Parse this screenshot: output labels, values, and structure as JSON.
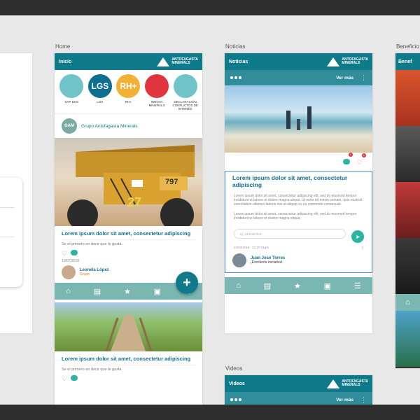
{
  "labels": {
    "home": "Home",
    "noticias": "Noticias",
    "videos": "Videos",
    "beneficios": "Beneficio"
  },
  "home": {
    "header_title": "Inicio",
    "logo_line1": "ANTOFAGASTA",
    "logo_line2": "MINERALS",
    "categories": [
      {
        "label": "SAP DHS",
        "icon": "worker-icon",
        "color": "#6fc3c9",
        "text": ""
      },
      {
        "label": "LGS",
        "icon": "lgs-icon",
        "color": "#0f6f8f",
        "text": "LGS"
      },
      {
        "label": "RH+",
        "icon": "rh-icon",
        "color": "#f2b134",
        "text": "RH+"
      },
      {
        "label": "INNOVA MINERALS",
        "icon": "bulb-icon",
        "color": "#e0353f",
        "text": ""
      },
      {
        "label": "DECLARACIÓN CONFLICTOS DE INTERÉS",
        "icon": "people-icon",
        "color": "#6fc3c9",
        "text": ""
      }
    ],
    "group_badge": "GAM",
    "group_name": "Grupo Antofagasta Minerals",
    "post_title": "Lorem ipsum dolor sit amet, consectetur adipiscing",
    "like_prompt": "Se el primero en decir que te gusta",
    "post_date": "10/07/2018",
    "user_name": "Leonela López",
    "user_group": "Grupo",
    "post2_title": "Lorem ipsum dolor sit amet, consectetur adipiscing",
    "like_prompt2": "Se el primero en decir que te gusta",
    "truck_number": "797",
    "truck_number2": "27",
    "fab_label": "+"
  },
  "noticias": {
    "header_title": "Noticias",
    "logo_line1": "ANTOFAGASTA",
    "logo_line2": "MINERALS",
    "ver_mas": "Ver más",
    "comment_count": "1",
    "like_count": "1",
    "title": "Lorem ipsum dolor sit amet, consectetur adipiscing",
    "paragraph1": "Lorem ipsum dolor sit amet, consectetur adipiscing elit, sed do eiusmod tempor incididunt ut labore et dolore magna aliqua. Ut enim ad minim veniam, quis nostrud exercitation ullamco laboris nisi ut aliquip ex ea commodo consequat.",
    "paragraph2": "Lorem ipsum dolor sit amet, consectetur adipiscing elit, sed do eiusmod tempor incididunt ut labore et dolore magna aliqua.",
    "input_placeholder": "Ej. 12345678-9",
    "date": "24/03/2018",
    "time": "21:37:01pm",
    "commenter": "Juan José Torres",
    "comment": "¡Excelente iniciativa!"
  },
  "videos": {
    "header_title": "Videos",
    "logo_line1": "ANTOFAGASTA",
    "logo_line2": "MINERALS",
    "ver_mas": "Ver más"
  },
  "beneficios": {
    "header_title": "Benef"
  },
  "nav_icons": [
    "home-icon",
    "news-icon",
    "star-icon",
    "contact-icon",
    "menu-icon"
  ]
}
